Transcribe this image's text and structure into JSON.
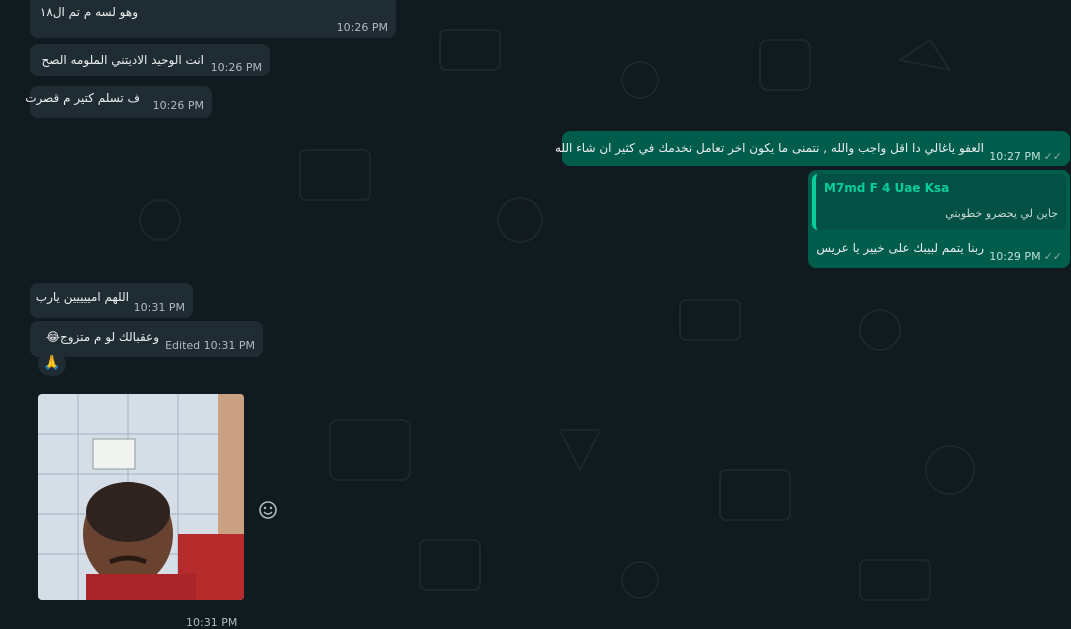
{
  "messages": [
    {
      "id": "m0",
      "direction": "incoming",
      "text": "وهو لسه م تم ال١٨",
      "time": "10:26 PM"
    },
    {
      "id": "m1",
      "direction": "incoming",
      "text": "انت الوحيد الاديتني الملومه الصح",
      "time": "10:26 PM"
    },
    {
      "id": "m2",
      "direction": "incoming",
      "text": "ف تسلم كتير م قصرت",
      "time": "10:26 PM"
    },
    {
      "id": "m3",
      "direction": "outgoing",
      "text": "العفو ياغالي دا اقل واجب والله , نتمنى ما يكون اخر تعامل نخدمك في كثير ان شاء الله",
      "time": "10:27 PM",
      "status": "read"
    },
    {
      "id": "m4",
      "direction": "outgoing",
      "quote": {
        "name": "M7md F 4 Uae Ksa",
        "text": "جاين لي يحضرو خطوبتي"
      },
      "text": "ربنا يتمم لبيبك على خيير يا عريس",
      "time": "10:29 PM",
      "status": "read"
    },
    {
      "id": "m5",
      "direction": "incoming",
      "text": "اللهم امييييين يارب",
      "time": "10:31 PM"
    },
    {
      "id": "m6",
      "direction": "incoming",
      "text": "وعقبالك لو م متزوج😂",
      "edited": "Edited",
      "time": "10:31 PM",
      "reaction": "🙏"
    },
    {
      "id": "m7",
      "direction": "incoming",
      "type": "image",
      "time": "10:31 PM"
    }
  ],
  "icons": {
    "emoji_react": "smiley-icon",
    "read_status": "double-check-icon"
  },
  "colors": {
    "incoming": "#202c33",
    "outgoing": "#005c4b",
    "quote_accent": "#06cf9c"
  }
}
